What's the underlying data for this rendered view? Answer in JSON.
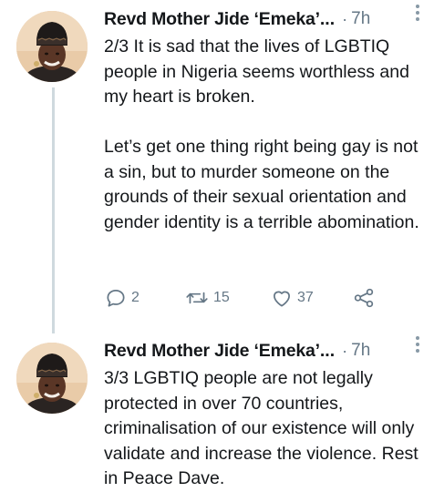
{
  "tweets": [
    {
      "author": "Revd Mother Jide ‘Emeka’",
      "truncation": "...",
      "separator": "·",
      "time": "7h",
      "text": "2/3 It is sad that the lives of LGBTIQ people in Nigeria seems worthless and my heart is broken.\n\nLet’s get one thing right being gay is not a sin, but to murder someone on the grounds of their sexual orientation and gender identity is a terrible abomination.",
      "replies": "2",
      "retweets": "15",
      "likes": "37"
    },
    {
      "author": "Revd Mother Jide ‘Emeka’",
      "truncation": "...",
      "separator": "·",
      "time": "7h",
      "text": "3/3 LGBTIQ people are not legally protected in over 70 countries, criminalisation of our existence will only validate and increase the violence. Rest in Peace Dave."
    }
  ],
  "icons": {
    "reply": "reply-icon",
    "retweet": "retweet-icon",
    "like": "heart-icon",
    "share": "share-icon",
    "more": "more-options-icon"
  },
  "colors": {
    "text": "#14171a",
    "muted": "#657786",
    "thread_line": "#cfd9de"
  }
}
